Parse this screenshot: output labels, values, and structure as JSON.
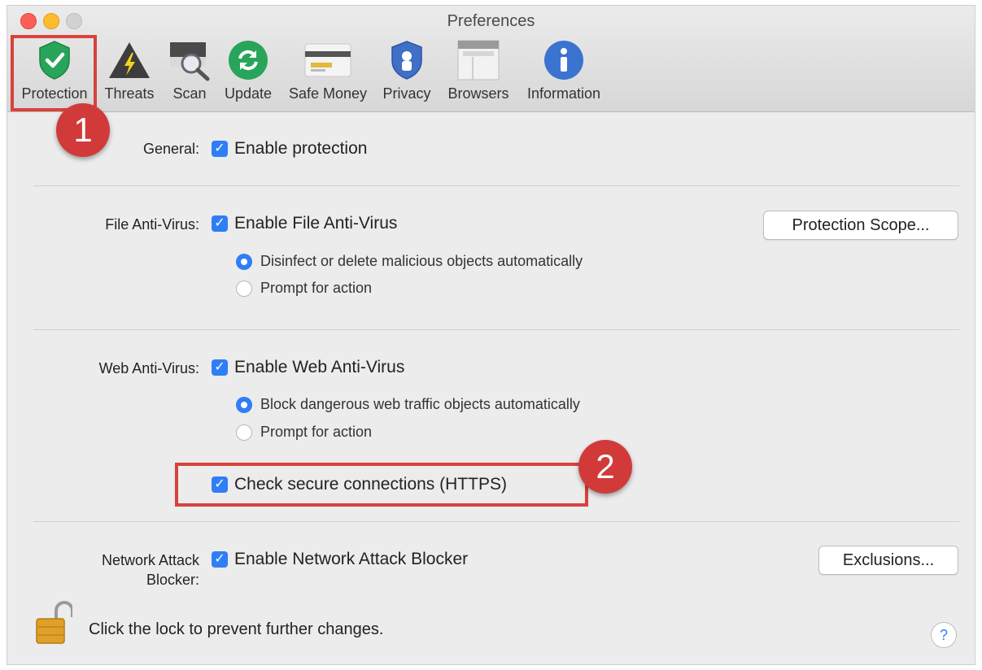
{
  "window": {
    "title": "Preferences"
  },
  "toolbar": {
    "items": [
      {
        "label": "Protection",
        "icon": "shield-check-icon"
      },
      {
        "label": "Threats",
        "icon": "warning-icon"
      },
      {
        "label": "Scan",
        "icon": "scan-magnifier-icon"
      },
      {
        "label": "Update",
        "icon": "refresh-icon"
      },
      {
        "label": "Safe Money",
        "icon": "credit-card-icon"
      },
      {
        "label": "Privacy",
        "icon": "privacy-shield-icon"
      },
      {
        "label": "Browsers",
        "icon": "browser-window-icon"
      },
      {
        "label": "Information",
        "icon": "info-icon"
      }
    ]
  },
  "annotations": {
    "badge1": "1",
    "badge2": "2",
    "color": "#d8423c"
  },
  "general": {
    "label": "General:",
    "enable_protection": "Enable protection",
    "checked": true
  },
  "file_av": {
    "label": "File Anti-Virus:",
    "enable": "Enable File Anti-Virus",
    "checked": true,
    "scope_button": "Protection Scope...",
    "options": [
      "Disinfect or delete malicious objects automatically",
      "Prompt for action"
    ],
    "selected": 0
  },
  "web_av": {
    "label": "Web Anti-Virus:",
    "enable": "Enable Web Anti-Virus",
    "checked": true,
    "options": [
      "Block dangerous web traffic objects automatically",
      "Prompt for action"
    ],
    "selected": 0,
    "https": "Check secure connections (HTTPS)",
    "https_checked": true
  },
  "network": {
    "label_line1": "Network Attack",
    "label_line2": "Blocker:",
    "enable": "Enable Network Attack Blocker",
    "checked": true,
    "exclusions_button": "Exclusions..."
  },
  "footer": {
    "lock_text": "Click the lock to prevent further changes.",
    "help": "?"
  },
  "colors": {
    "accent": "#2f7ef5",
    "green": "#28a55a"
  }
}
